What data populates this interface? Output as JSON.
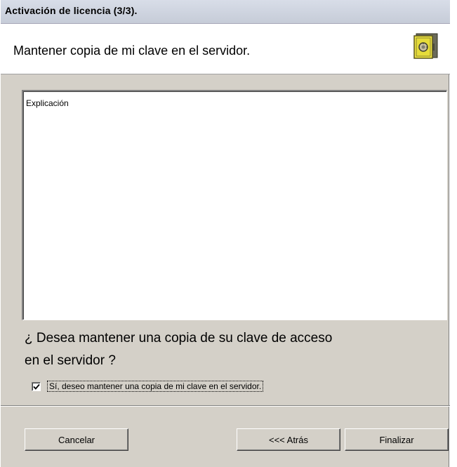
{
  "window": {
    "title": "Activación de licencia (3/3)."
  },
  "header": {
    "text": "Mantener copia de mi clave en el servidor.",
    "icon": "safe-icon"
  },
  "explanation": {
    "text": "Explicación"
  },
  "question": {
    "line1": "¿ Desea mantener una copia de su clave de acceso",
    "line2": "en el servidor ?"
  },
  "checkbox": {
    "checked": true,
    "label": "Sí, deseo mantener una copia de mi clave en el servidor."
  },
  "buttons": {
    "cancel": "Cancelar",
    "back": "<<< Atrás",
    "finish": "Finalizar"
  }
}
